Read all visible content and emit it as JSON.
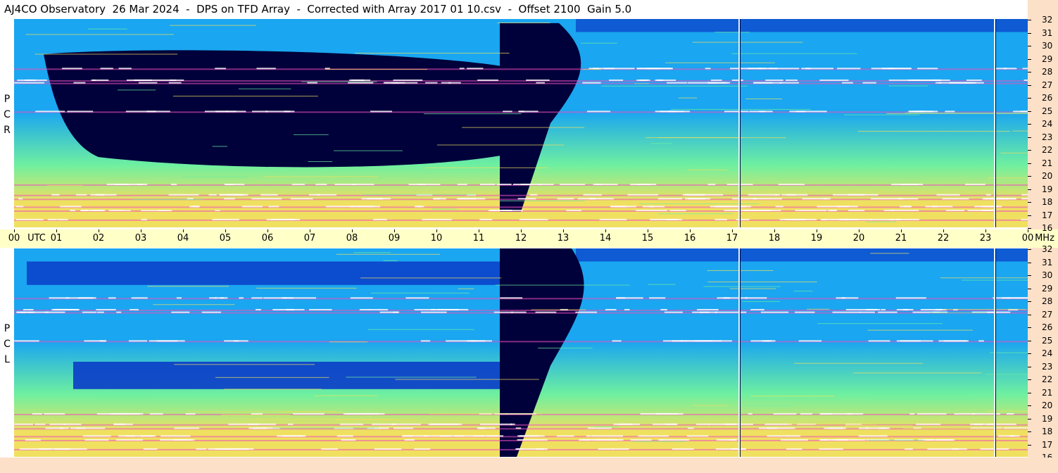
{
  "title": "AJ4CO Observatory  26 Mar 2024  -  DPS on TFD Array  -  Corrected with Array 2017 01 10.csv  -  Offset 2100  Gain 5.0",
  "panels": [
    {
      "id": "rcp",
      "label_letters": [
        "P",
        "C",
        "R"
      ]
    },
    {
      "id": "lcp",
      "label_letters": [
        "P",
        "C",
        "L"
      ]
    }
  ],
  "chart_data": {
    "type": "heatmap",
    "title": "AJ4CO Observatory  26 Mar 2024  -  DPS on TFD Array  -  Corrected with Array 2017 01 10.csv  -  Offset 2100  Gain 5.0",
    "xlabel": "UTC",
    "ylabel": "MHz",
    "x_ticks": [
      "00",
      "01",
      "02",
      "03",
      "04",
      "05",
      "06",
      "07",
      "08",
      "09",
      "10",
      "11",
      "12",
      "13",
      "14",
      "15",
      "16",
      "17",
      "18",
      "19",
      "20",
      "21",
      "22",
      "23",
      "00"
    ],
    "y_ticks": [
      32,
      31,
      30,
      29,
      28,
      27,
      26,
      25,
      24,
      23,
      22,
      21,
      20,
      19,
      18,
      17,
      16
    ],
    "xlim_hours": [
      0,
      24
    ],
    "ylim_mhz": [
      16,
      32
    ],
    "series": [
      {
        "name": "RCP",
        "dark_region_hours": [
          0.7,
          12.8
        ]
      },
      {
        "name": "LCP",
        "dark_region_hours": [
          11.5,
          13.0
        ]
      }
    ],
    "vertical_lines_hours": [
      17.15,
      23.2
    ],
    "colors": {
      "low": "#00003a",
      "mid_low": "#0a3cc8",
      "mid": "#1aa6f0",
      "mid_high": "#6ef0a0",
      "high": "#f0e060",
      "peak": "#f050c0"
    }
  },
  "time_axis": {
    "start_label": "00",
    "unit_label": "UTC",
    "end_label": "00",
    "end_unit_label": "MHz"
  }
}
